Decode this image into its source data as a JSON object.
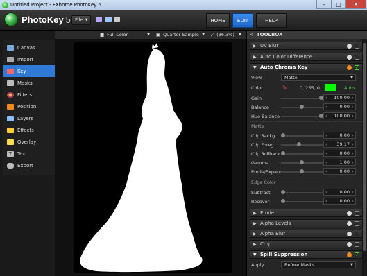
{
  "window": {
    "title": "Untitled Project - FXhome PhotoKey 5",
    "min": "–",
    "max": "□",
    "close": "✕"
  },
  "app": {
    "logo_name": "PhotoKey",
    "logo_ver": "5",
    "file_menu": "File",
    "nav": [
      "HOME",
      "EDIT",
      "HELP"
    ]
  },
  "sidebar": {
    "items": [
      {
        "label": "Canvas",
        "color": "#7aa9dd"
      },
      {
        "label": "Import",
        "color": "#aaaaaa"
      },
      {
        "label": "Key",
        "color": "#ff6666"
      },
      {
        "label": "Masks",
        "color": "#bbbbbb"
      },
      {
        "label": "Filters",
        "color": "#e0c040"
      },
      {
        "label": "Position",
        "color": "#f08a20"
      },
      {
        "label": "Layers",
        "color": "#88c0ff"
      },
      {
        "label": "Effects",
        "color": "#ffcc33"
      },
      {
        "label": "Overlay",
        "color": "#ffdd55"
      },
      {
        "label": "Text",
        "color": "#bbbbbb"
      },
      {
        "label": "Export",
        "color": "#bbbbbb"
      }
    ]
  },
  "viewer": {
    "color_mode": "Full Color",
    "sample": "Quarter Sample",
    "zoom": "(36.3%)"
  },
  "toolbox": {
    "title": "TOOLBOX",
    "uv_blur": "UV Blur",
    "auto_color_diff": "Auto Color Difference",
    "auto_chroma": "Auto Chroma Key",
    "view_label": "View",
    "view_value": "Matte",
    "color_label": "Color",
    "color_value": "0, 255, 0",
    "color_hex": "#00ff00",
    "auto": "Auto",
    "gain_label": "Gain",
    "gain": "100.00",
    "balance_label": "Balance",
    "balance": "0.00",
    "hue_label": "Hue Balance",
    "hue": "100.00",
    "matte_hdr": "Matte",
    "clip_back_label": "Clip Backg.",
    "clip_back": "0.00",
    "clip_fore_label": "Clip Foreg.",
    "clip_fore": "39.17",
    "clip_roll_label": "Clip Rollback",
    "clip_roll": "0.00",
    "gamma_label": "Gamma",
    "gamma": "1.00",
    "erode_exp_label": "Erode/Expand",
    "erode_exp": "0.00",
    "edge_hdr": "Edge Color",
    "subtract_label": "Subtract",
    "subtract": "0.00",
    "recover_label": "Recover",
    "recover": "0.00",
    "erode": "Erode",
    "alpha_levels": "Alpha Levels",
    "alpha_blur": "Alpha Blur",
    "crop": "Crop",
    "spill": "Spill Suppression",
    "apply_label": "Apply",
    "apply_value": "Before Masks"
  }
}
